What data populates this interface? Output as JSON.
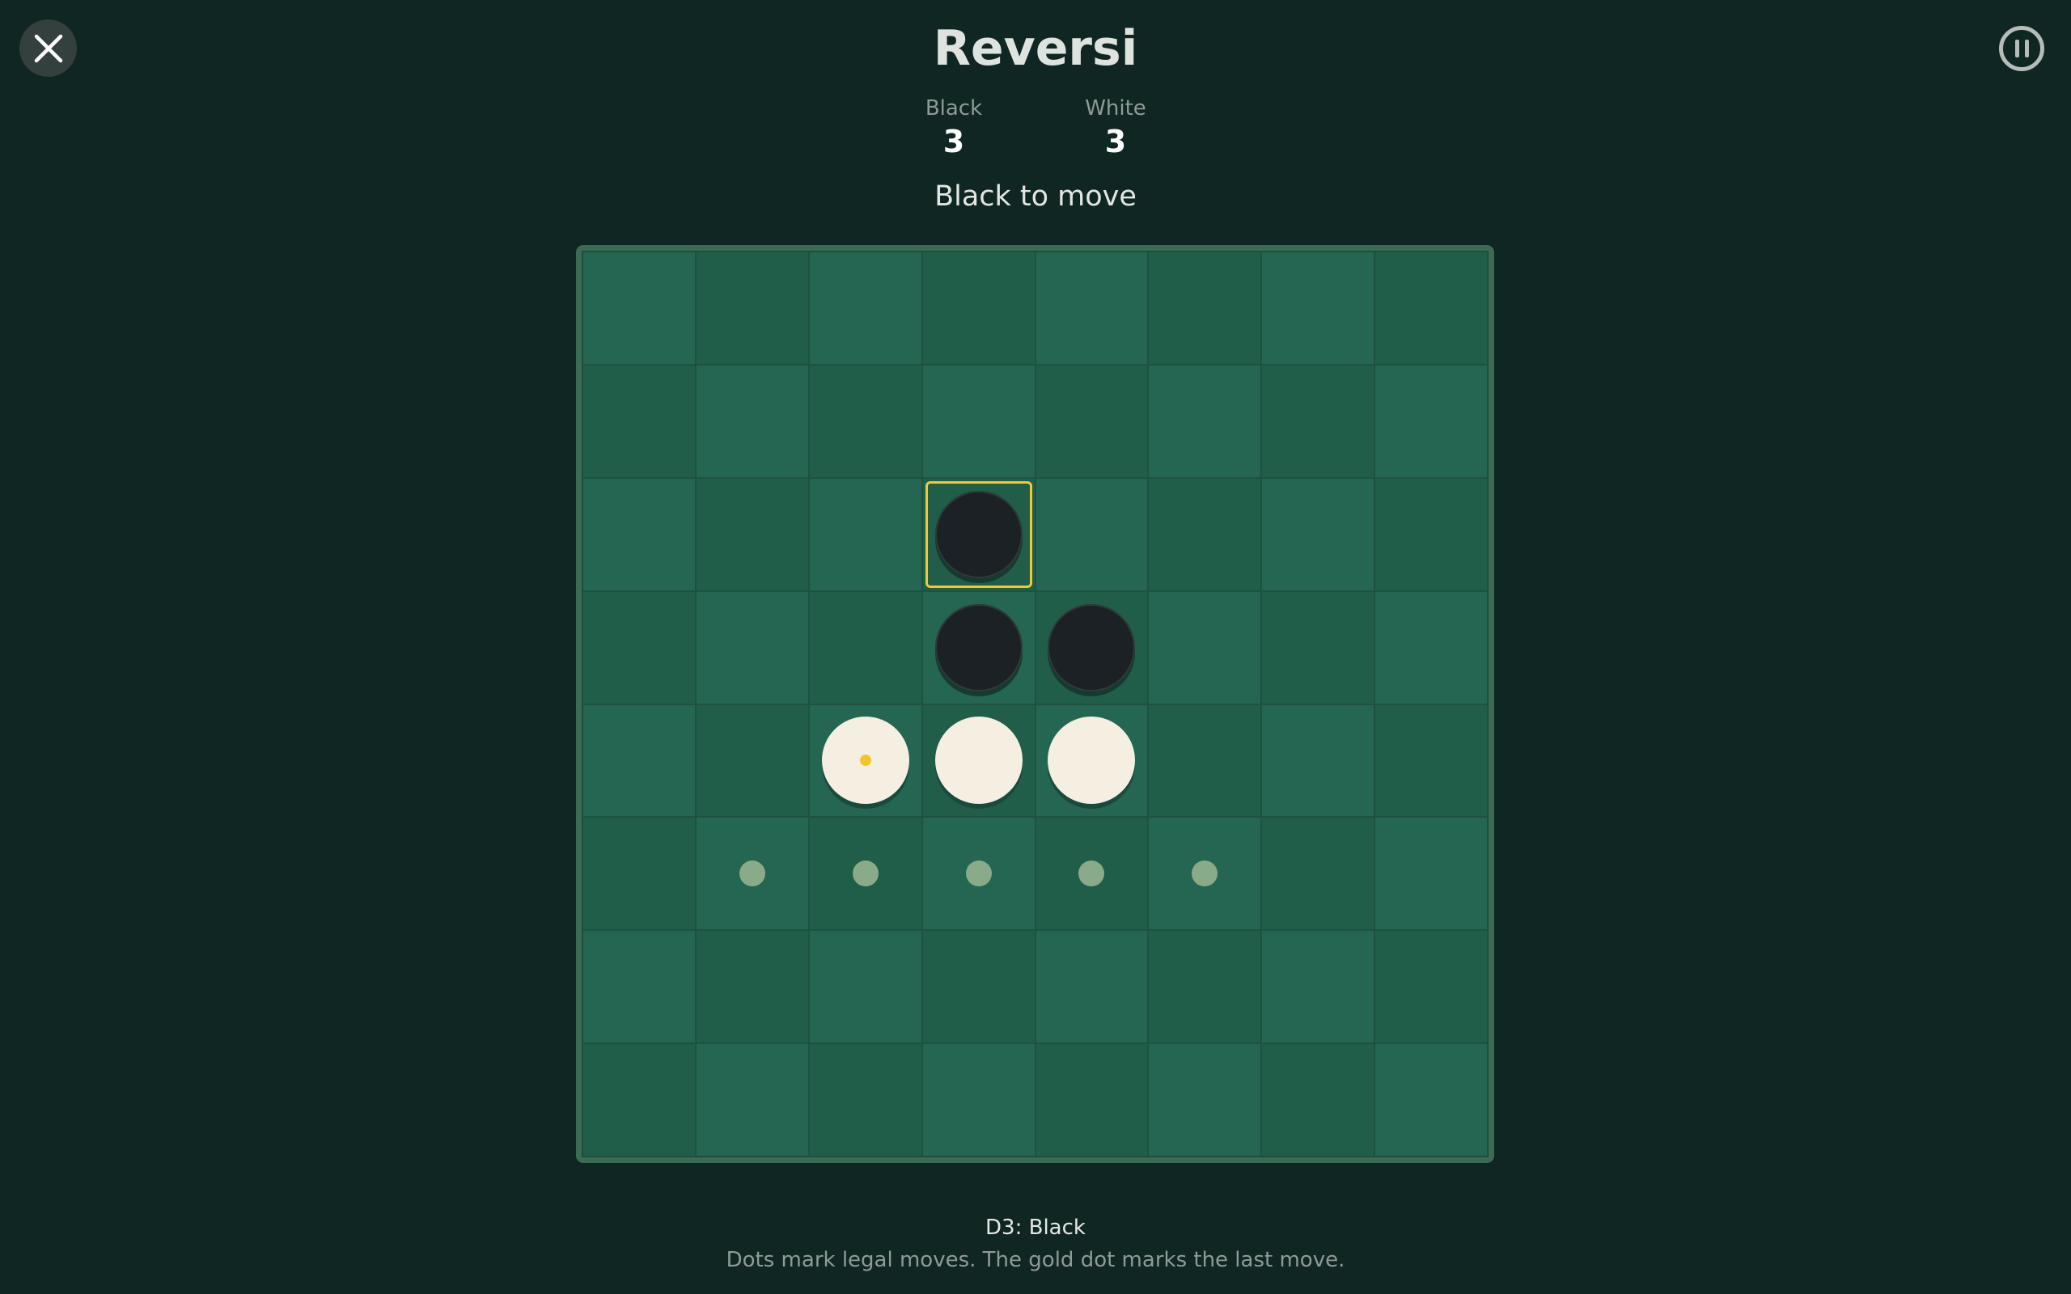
{
  "header": {
    "title": "Reversi",
    "close_icon": "close-icon",
    "pause_icon": "pause-icon"
  },
  "scores": [
    {
      "label": "Black",
      "value": "3"
    },
    {
      "label": "White",
      "value": "3"
    }
  ],
  "status": "Black to move",
  "board": {
    "rows": 8,
    "cols": 8,
    "colors": {
      "light_square": "#246651",
      "dark_square": "#205e4a",
      "last_move_outline": "#f1c930",
      "hint_dot": "#8aab89",
      "gold_dot": "#f2c530"
    },
    "grid": [
      [
        "",
        "",
        "",
        "",
        "",
        "",
        "",
        ""
      ],
      [
        "",
        "",
        "",
        "",
        "",
        "",
        "",
        ""
      ],
      [
        "",
        "",
        "",
        "B",
        "",
        "",
        "",
        ""
      ],
      [
        "",
        "",
        "",
        "B",
        "B",
        "",
        "",
        ""
      ],
      [
        "",
        "",
        "W",
        "W",
        "W",
        "",
        "",
        ""
      ],
      [
        "",
        ".",
        ".",
        ".",
        ".",
        ".",
        "",
        ""
      ],
      [
        "",
        "",
        "",
        "",
        "",
        "",
        "",
        ""
      ],
      [
        "",
        "",
        "",
        "",
        "",
        "",
        "",
        ""
      ]
    ],
    "last_move_cell": [
      2,
      3
    ],
    "gold_dot_cell": [
      4,
      2
    ]
  },
  "footer": {
    "last_move": "D3: Black",
    "note": "Dots mark legal moves. The gold dot marks the last move."
  }
}
